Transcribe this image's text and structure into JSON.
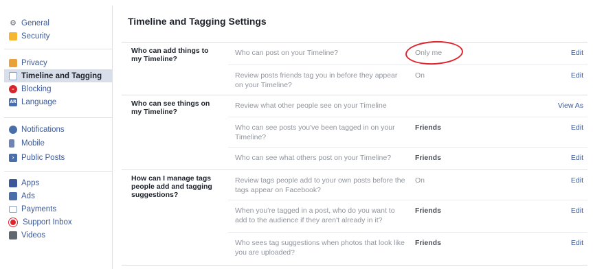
{
  "sidebar": {
    "group1": [
      {
        "label": "General",
        "icon": "gear-icon"
      },
      {
        "label": "Security",
        "icon": "shield-icon"
      }
    ],
    "group2": [
      {
        "label": "Privacy",
        "icon": "lock-icon"
      },
      {
        "label": "Timeline and Tagging",
        "icon": "timeline-icon",
        "active": true
      },
      {
        "label": "Blocking",
        "icon": "block-icon"
      },
      {
        "label": "Language",
        "icon": "language-icon"
      }
    ],
    "group3": [
      {
        "label": "Notifications",
        "icon": "globe-icon"
      },
      {
        "label": "Mobile",
        "icon": "phone-icon"
      },
      {
        "label": "Public Posts",
        "icon": "rss-icon"
      }
    ],
    "group4": [
      {
        "label": "Apps",
        "icon": "apps-icon"
      },
      {
        "label": "Ads",
        "icon": "ads-icon"
      },
      {
        "label": "Payments",
        "icon": "card-icon"
      },
      {
        "label": "Support Inbox",
        "icon": "lifebuoy-icon"
      },
      {
        "label": "Videos",
        "icon": "film-icon"
      }
    ]
  },
  "main": {
    "title": "Timeline and Tagging Settings",
    "sections": [
      {
        "header": "Who can add things to my Timeline?",
        "rows": [
          {
            "question": "Who can post on your Timeline?",
            "value": "Only me",
            "action": "Edit"
          },
          {
            "question": "Review posts friends tag you in before they appear on your Timeline?",
            "value": "On",
            "action": "Edit"
          }
        ]
      },
      {
        "header": "Who can see things on my Timeline?",
        "rows": [
          {
            "question": "Review what other people see on your Timeline",
            "value": "",
            "action": "View As"
          },
          {
            "question": "Who can see posts you've been tagged in on your Timeline?",
            "value": "Friends",
            "action": "Edit"
          },
          {
            "question": "Who can see what others post on your Timeline?",
            "value": "Friends",
            "action": "Edit"
          }
        ]
      },
      {
        "header": "How can I manage tags people add and tagging suggestions?",
        "rows": [
          {
            "question": "Review tags people add to your own posts before the tags appear on Facebook?",
            "value": "On",
            "action": "Edit"
          },
          {
            "question": "When you're tagged in a post, who do you want to add to the audience if they aren't already in it?",
            "value": "Friends",
            "action": "Edit"
          },
          {
            "question": "Who sees tag suggestions when photos that look like you are uploaded?",
            "value": "Friends",
            "action": "Edit"
          }
        ]
      }
    ]
  },
  "colors": {
    "link": "#3b5998",
    "highlight_circle": "#e0232c",
    "active_bg": "#d8dfea"
  }
}
